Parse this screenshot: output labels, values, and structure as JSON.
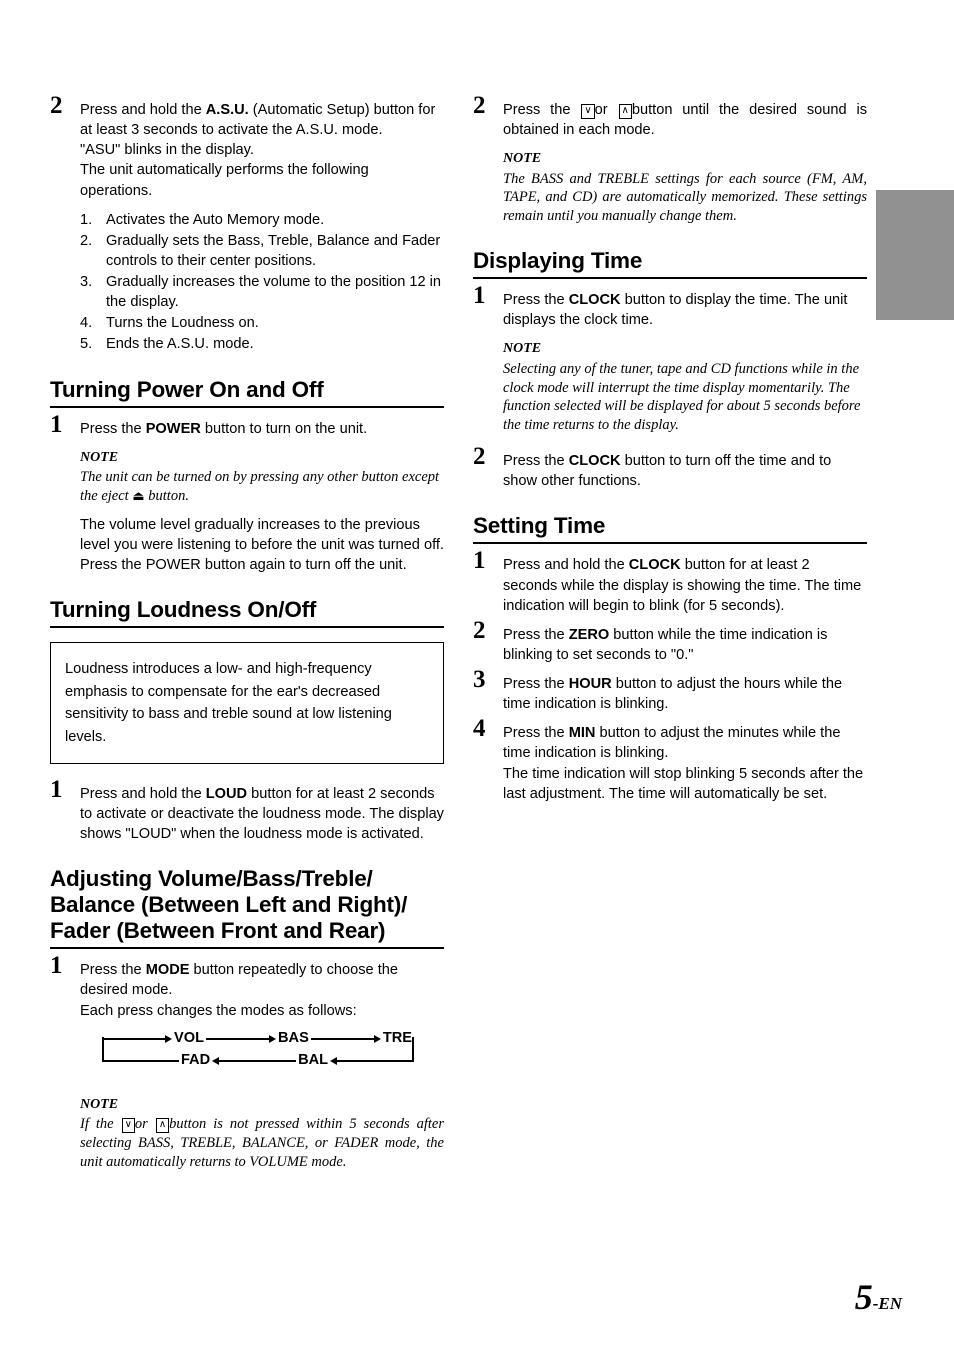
{
  "page": {
    "number": "5",
    "suffix": "-EN"
  },
  "thumb_tab": {
    "color": "#919191"
  },
  "left_column": {
    "step_asu": {
      "number": "2",
      "lines": [
        "Press and hold the A.S.U. (Automatic Setup) button for at least 3 seconds to activate the A.S.U. mode.",
        "\"ASU\" blinks in the display.",
        "The unit automatically performs the following operations."
      ],
      "bold_terms": [
        "A.S.U."
      ],
      "sublist": [
        {
          "num": "1.",
          "text": "Activates the Auto Memory mode."
        },
        {
          "num": "2.",
          "text": "Gradually sets the Bass, Treble, Balance and Fader controls to their center positions."
        },
        {
          "num": "3.",
          "text": "Gradually increases the volume to the position 12 in the display."
        },
        {
          "num": "4.",
          "text": "Turns the Loudness on."
        },
        {
          "num": "5.",
          "text": "Ends the A.S.U. mode."
        }
      ]
    },
    "heading_power": "Turning Power On and Off",
    "step_power": {
      "number": "1",
      "text_before_bold": "Press the ",
      "bold": "POWER",
      "text_after_bold": " button to turn on the unit.",
      "note_title": "NOTE",
      "note_part1": "The unit can be turned on by pressing any other button except the eject ",
      "note_eject_glyph": "⏏",
      "note_part2": " button.",
      "paragraph": "The volume level gradually increases to the previous level you were listening to before the unit was turned off. Press the POWER button again to turn off the unit."
    },
    "heading_loudness": "Turning Loudness On/Off",
    "loudness_box": "Loudness introduces a low- and high-frequency emphasis  to compensate for the ear's decreased sensitivity to bass and treble sound at low listening levels.",
    "step_loud": {
      "number": "1",
      "text_before_bold": "Press and hold the ",
      "bold": "LOUD",
      "text_after_bold": " button for at least 2 seconds to activate or deactivate the loudness mode. The display shows \"LOUD\" when the loudness mode is activated."
    },
    "heading_adjusting": "Adjusting Volume/Bass/Treble/ Balance (Between Left and Right)/ Fader (Between Front and Rear)",
    "step_mode": {
      "number": "1",
      "text_before_bold": "Press the ",
      "bold": "MODE",
      "text_after_bold": " button repeatedly to choose the desired mode.",
      "line2": "Each press changes the modes as follows:"
    },
    "mode_diagram": {
      "top_row": [
        "VOL",
        "BAS",
        "TRE"
      ],
      "bottom_row": [
        "FAD",
        "BAL"
      ]
    },
    "note_bottom": {
      "title": "NOTE",
      "part1": "If the ",
      "key_down": "∨",
      "part2": "or ",
      "key_up": "∧",
      "part3": "button is not pressed within 5 seconds after selecting BASS, TREBLE, BALANCE, or FADER mode, the unit automatically returns to VOLUME mode."
    }
  },
  "right_column": {
    "step_sound": {
      "number": "2",
      "part1": "Press the ",
      "key_down": "∨",
      "part2": "or ",
      "key_up": "∧",
      "part3": "button until the desired sound is obtained in each mode.",
      "note_title": "NOTE",
      "note_body": "The BASS and TREBLE settings for each source (FM, AM, TAPE, and CD) are automatically memorized. These settings remain until you manually change them."
    },
    "heading_displaying_time": "Displaying Time",
    "step_clock_on": {
      "number": "1",
      "text_before_bold": "Press the ",
      "bold": "CLOCK",
      "text_after_bold": " button to display the time. The unit displays the clock time.",
      "note_title": "NOTE",
      "note_body": "Selecting any of the tuner, tape and CD functions while in the clock mode will interrupt the time display momentarily. The function selected will be displayed for about 5 seconds before the time returns to the display."
    },
    "step_clock_off": {
      "number": "2",
      "text_before_bold": "Press the ",
      "bold": "CLOCK",
      "text_after_bold": " button to turn off the time and to show other functions."
    },
    "heading_setting_time": "Setting Time",
    "step_hold_clock": {
      "number": "1",
      "text_before_bold": "Press and hold the ",
      "bold": "CLOCK",
      "text_after_bold": " button for at least 2 seconds while the display is showing the time. The time indication will begin to blink (for 5 seconds)."
    },
    "step_zero": {
      "number": "2",
      "text_before_bold": "Press the ",
      "bold": "ZERO",
      "text_after_bold": " button while the time indication is blinking to set seconds to \"0.\""
    },
    "step_hour": {
      "number": "3",
      "text_before_bold": "Press the ",
      "bold": "HOUR",
      "text_after_bold": " button to adjust the hours while the time indication is blinking."
    },
    "step_min": {
      "number": "4",
      "text_before_bold": "Press the ",
      "bold": "MIN",
      "text_after_bold": " button to adjust the minutes while the time indication is blinking.",
      "line2": "The time indication will stop blinking 5 seconds after the last adjustment. The time will automatically be set."
    }
  }
}
